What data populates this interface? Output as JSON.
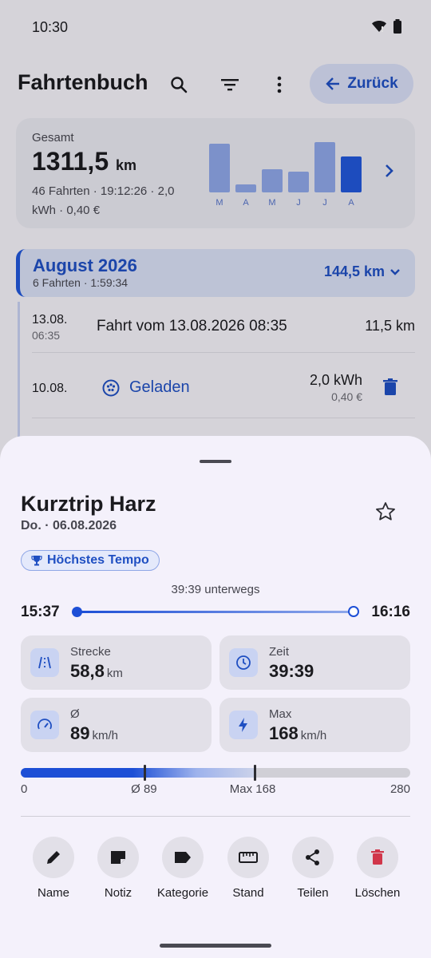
{
  "status_bar": {
    "time": "10:30"
  },
  "app_bar": {
    "title": "Fahrtenbuch",
    "back_label": "Zurück"
  },
  "summary": {
    "label": "Gesamt",
    "distance": "1311,5",
    "distance_unit": "km",
    "details": "46 Fahrten · 19:12:26 · 2,0 kWh · 0,40 €",
    "chart_data": {
      "type": "bar",
      "categories": [
        "M",
        "A",
        "M",
        "J",
        "J",
        "A"
      ],
      "values": [
        61,
        10,
        29,
        26,
        63,
        45
      ],
      "highlighted_index": 5
    }
  },
  "month_group": {
    "title": "August 2026",
    "subtitle": "6 Fahrten · 1:59:34",
    "distance": "144,5 km"
  },
  "trips": [
    {
      "date": "13.08.",
      "time": "06:35",
      "title": "Fahrt vom 13.08.2026 08:35",
      "distance": "11,5 km"
    }
  ],
  "charge": {
    "date": "10.08.",
    "label": "Geladen",
    "energy": "2,0 kWh",
    "cost": "0,40 €"
  },
  "sheet": {
    "title": "Kurztrip Harz",
    "date": "Do. · 06.08.2026",
    "badge": "Höchstes Tempo",
    "duration": "39:39 unterwegs",
    "start_time": "15:37",
    "end_time": "16:16",
    "stats": [
      {
        "label": "Strecke",
        "value": "58,8",
        "unit": "km"
      },
      {
        "label": "Zeit",
        "value": "39:39",
        "unit": ""
      },
      {
        "label": "Ø",
        "value": "89",
        "unit": "km/h"
      },
      {
        "label": "Max",
        "value": "168",
        "unit": "km/h"
      }
    ],
    "speed_scale": {
      "min_label": "0",
      "avg_label": "Ø 89",
      "max_label": "Max 168",
      "end_label": "280",
      "min": 0,
      "avg": 89,
      "max": 168,
      "end": 280
    },
    "actions": [
      "Name",
      "Notiz",
      "Kategorie",
      "Stand",
      "Teilen",
      "Löschen"
    ]
  },
  "colors": {
    "accent": "#1f4fc2",
    "delete": "#d1364a"
  }
}
